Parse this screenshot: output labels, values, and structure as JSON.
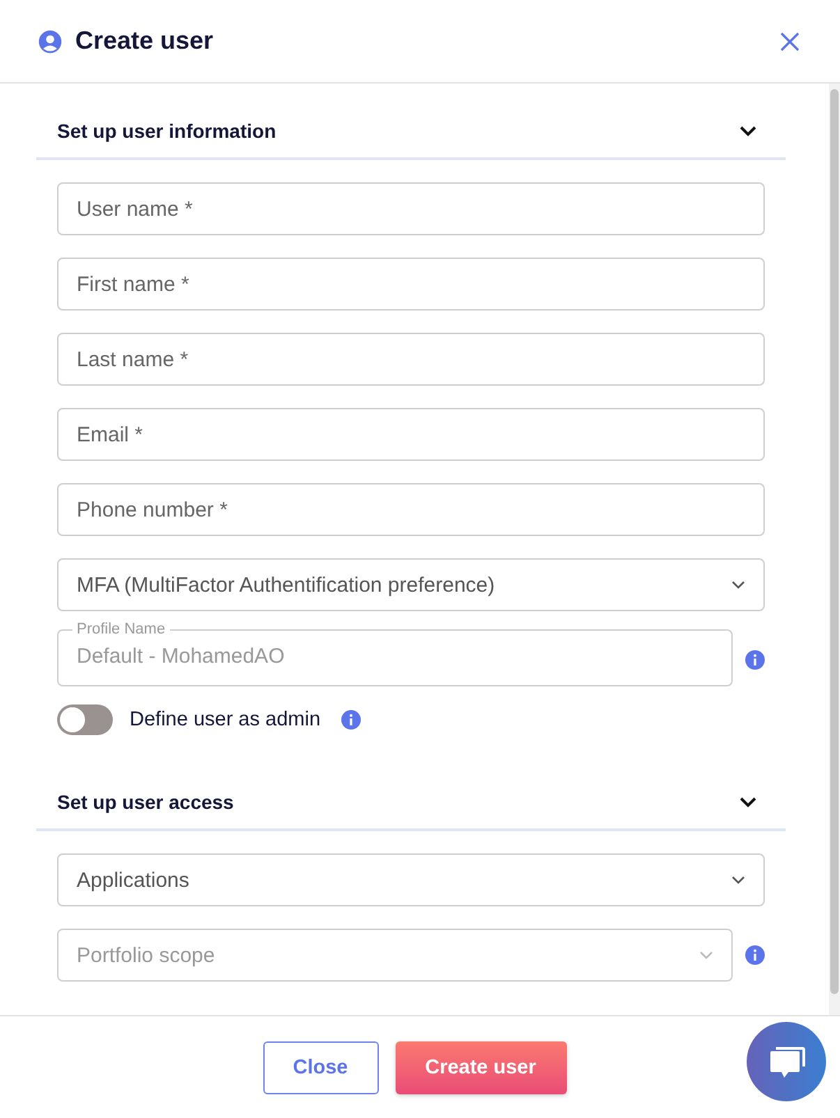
{
  "header": {
    "title": "Create user"
  },
  "sections": [
    {
      "title": "Set up user information",
      "expanded": true,
      "fields": [
        {
          "kind": "text",
          "placeholder": "User name *"
        },
        {
          "kind": "text",
          "placeholder": "First name *"
        },
        {
          "kind": "text",
          "placeholder": "Last name *"
        },
        {
          "kind": "text",
          "placeholder": "Email *"
        },
        {
          "kind": "text",
          "placeholder": "Phone number *"
        },
        {
          "kind": "select",
          "placeholder": "MFA (MultiFactor Authentification preference)",
          "disabled": false,
          "info": false
        },
        {
          "kind": "outlined",
          "label": "Profile Name",
          "value": "Default - MohamedAO",
          "disabled": true,
          "info": true
        },
        {
          "kind": "toggle",
          "label": "Define user as admin",
          "on": false,
          "info": true
        }
      ]
    },
    {
      "title": "Set up user access",
      "expanded": true,
      "fields": [
        {
          "kind": "select",
          "placeholder": "Applications",
          "disabled": false,
          "info": false
        },
        {
          "kind": "select",
          "placeholder": "Portfolio scope",
          "disabled": true,
          "info": true
        }
      ]
    }
  ],
  "buttons": [
    {
      "kind": "secondary",
      "label": "Close"
    },
    {
      "kind": "primary",
      "label": "Create user"
    }
  ]
}
